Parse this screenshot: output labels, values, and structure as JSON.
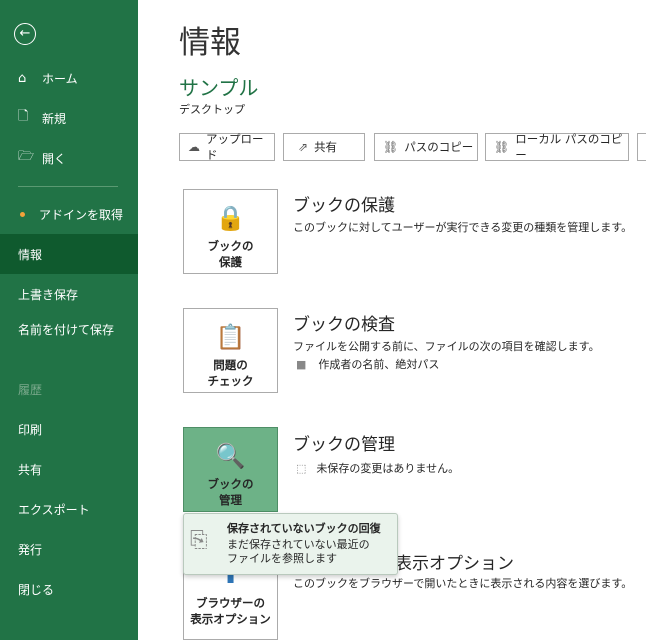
{
  "sidebar": {
    "items": [
      {
        "label": "ホーム",
        "icon": "home-icon"
      },
      {
        "label": "新規",
        "icon": "new-file-icon"
      },
      {
        "label": "開く",
        "icon": "open-folder-icon"
      },
      {
        "label": "アドインを取得"
      },
      {
        "label": "情報"
      },
      {
        "label": "上書き保存"
      },
      {
        "label": "名前を付けて保存"
      },
      {
        "label": "履歴"
      },
      {
        "label": "印刷"
      },
      {
        "label": "共有"
      },
      {
        "label": "エクスポート"
      },
      {
        "label": "発行"
      },
      {
        "label": "閉じる"
      }
    ]
  },
  "page": {
    "title": "情報",
    "file_name": "サンプル",
    "location": "デスクトップ"
  },
  "toolbar": {
    "upload": "アップロード",
    "share": "共有",
    "copy_path": "パスのコピー",
    "copy_local_path": "ローカル パスのコピー"
  },
  "sections": [
    {
      "button": "ブックの\n保護",
      "heading": "ブックの保護",
      "desc": "このブックに対してユーザーが実行できる変更の種類を管理します。"
    },
    {
      "button": "問題の\nチェック",
      "heading": "ブックの検査",
      "desc": "ファイルを公開する前に、ファイルの次の項目を確認します。",
      "bullet": "作成者の名前、絶対パス"
    },
    {
      "button": "ブックの\n管理",
      "heading": "ブックの管理",
      "desc": "未保存の変更はありません。"
    },
    {
      "button": "ブラウザーの\n表示オプション",
      "heading": "ブラウザーの表示オプション",
      "desc": "このブックをブラウザーで開いたときに表示される内容を選びます。"
    }
  ],
  "popup": {
    "title": "保存されていないブックの回復",
    "desc": "まだ保存されていない最近の\nファイルを参照します"
  }
}
